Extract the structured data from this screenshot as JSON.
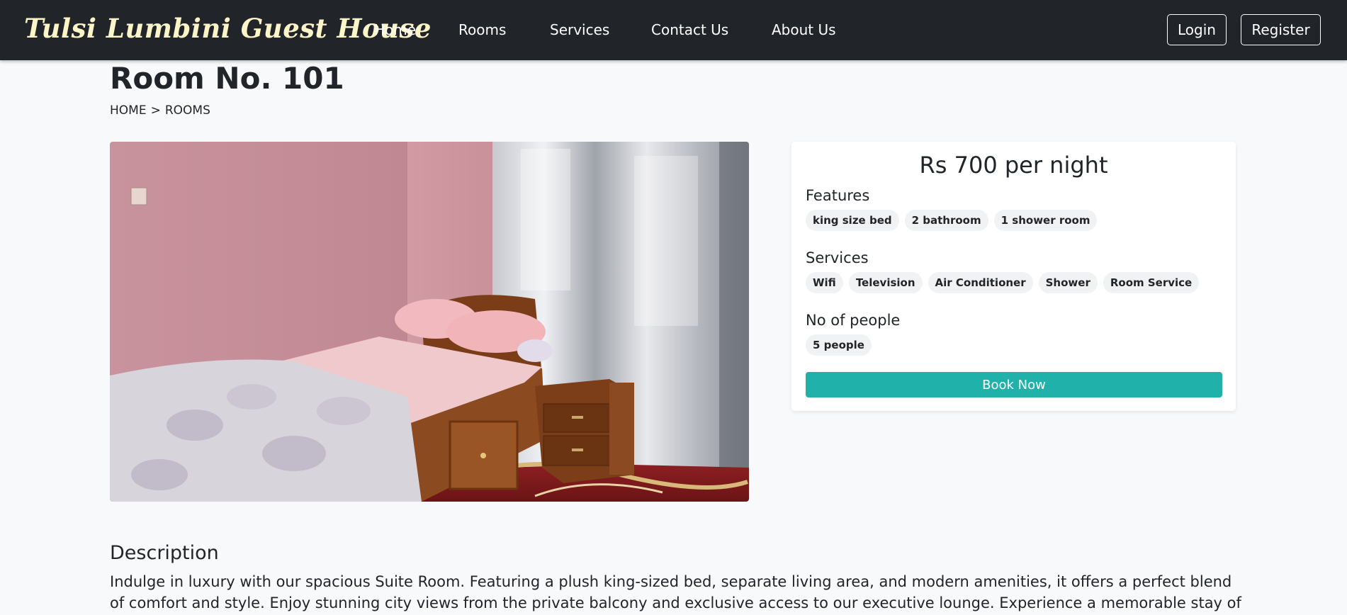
{
  "navbar": {
    "brand": "Tulsi Lumbini Guest House",
    "links": [
      "Home",
      "Rooms",
      "Services",
      "Contact Us",
      "About Us"
    ],
    "login": "Login",
    "register": "Register"
  },
  "page": {
    "title": "Room No. 101",
    "breadcrumb": [
      "HOME",
      ">",
      "ROOMS"
    ]
  },
  "card": {
    "price": "Rs 700 per night",
    "features_title": "Features",
    "features": [
      "king size bed",
      "2 bathroom",
      "1 shower room"
    ],
    "services_title": "Services",
    "services": [
      "Wifi",
      "Television",
      "Air Conditioner",
      "Shower",
      "Room Service"
    ],
    "people_title": "No of people",
    "people": [
      "5 people"
    ],
    "book_label": "Book Now"
  },
  "description": {
    "title": "Description",
    "text": "Indulge in luxury with our spacious Suite Room. Featuring a plush king-sized bed, separate living area, and modern amenities, it offers a perfect blend of comfort and style. Enjoy stunning city views from the private balcony and exclusive access to our executive lounge. Experience a memorable stay of"
  },
  "colors": {
    "navbar_bg": "#212529",
    "brand": "#fbf5c8",
    "accent": "#20b2aa",
    "page_bg": "#f8f9fa"
  }
}
